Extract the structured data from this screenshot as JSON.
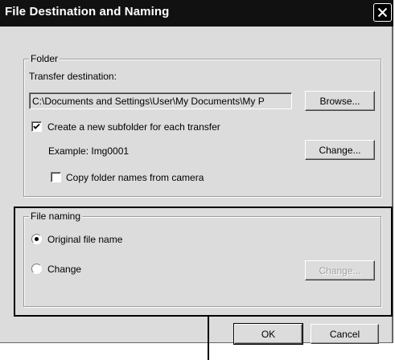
{
  "window": {
    "title": "File Destination and Naming",
    "close_glyph": "✕"
  },
  "folder_group": {
    "legend": "Folder",
    "transfer_label": "Transfer destination:",
    "path_value": "C:\\Documents and Settings\\User\\My Documents\\My P",
    "browse_label": "Browse...",
    "subfolder_checkbox_label": "Create a new subfolder for each transfer",
    "subfolder_checked": true,
    "example_text": "Example: Img0001",
    "change_label": "Change...",
    "copy_names_label": "Copy folder names from camera",
    "copy_names_checked": false
  },
  "naming_group": {
    "legend": "File naming",
    "original_label": "Original file name",
    "change_radio_label": "Change",
    "selected": "original",
    "change_button_label": "Change..."
  },
  "footer": {
    "ok_label": "OK",
    "cancel_label": "Cancel"
  },
  "icons": {
    "close": "close-icon",
    "checkmark": "checkmark-icon"
  },
  "colors": {
    "titlebar": "#111111",
    "dialog_bg": "#dcdcdc",
    "disabled_text": "#a0a0a0"
  }
}
